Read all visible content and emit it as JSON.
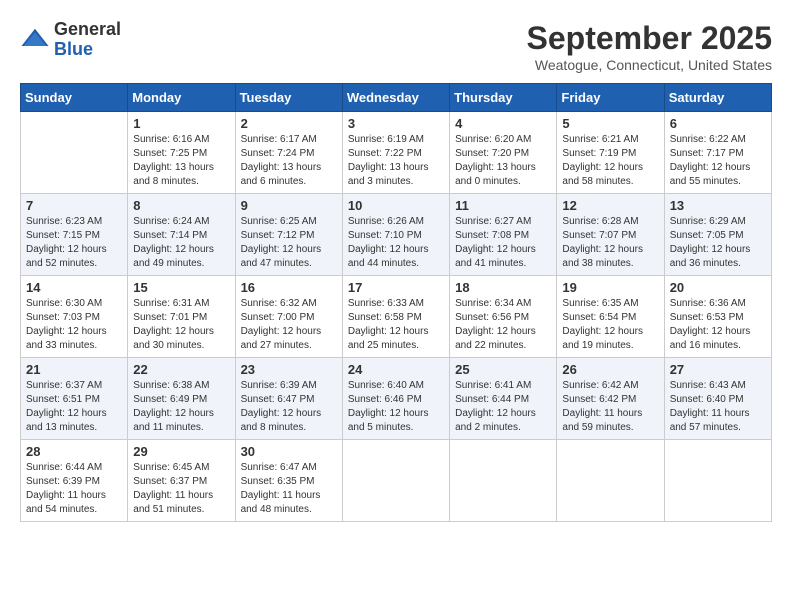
{
  "header": {
    "logo": {
      "general": "General",
      "blue": "Blue"
    },
    "month": "September 2025",
    "location": "Weatogue, Connecticut, United States"
  },
  "calendar": {
    "days_of_week": [
      "Sunday",
      "Monday",
      "Tuesday",
      "Wednesday",
      "Thursday",
      "Friday",
      "Saturday"
    ],
    "weeks": [
      [
        {
          "day": "",
          "info": ""
        },
        {
          "day": "1",
          "info": "Sunrise: 6:16 AM\nSunset: 7:25 PM\nDaylight: 13 hours\nand 8 minutes."
        },
        {
          "day": "2",
          "info": "Sunrise: 6:17 AM\nSunset: 7:24 PM\nDaylight: 13 hours\nand 6 minutes."
        },
        {
          "day": "3",
          "info": "Sunrise: 6:19 AM\nSunset: 7:22 PM\nDaylight: 13 hours\nand 3 minutes."
        },
        {
          "day": "4",
          "info": "Sunrise: 6:20 AM\nSunset: 7:20 PM\nDaylight: 13 hours\nand 0 minutes."
        },
        {
          "day": "5",
          "info": "Sunrise: 6:21 AM\nSunset: 7:19 PM\nDaylight: 12 hours\nand 58 minutes."
        },
        {
          "day": "6",
          "info": "Sunrise: 6:22 AM\nSunset: 7:17 PM\nDaylight: 12 hours\nand 55 minutes."
        }
      ],
      [
        {
          "day": "7",
          "info": "Sunrise: 6:23 AM\nSunset: 7:15 PM\nDaylight: 12 hours\nand 52 minutes."
        },
        {
          "day": "8",
          "info": "Sunrise: 6:24 AM\nSunset: 7:14 PM\nDaylight: 12 hours\nand 49 minutes."
        },
        {
          "day": "9",
          "info": "Sunrise: 6:25 AM\nSunset: 7:12 PM\nDaylight: 12 hours\nand 47 minutes."
        },
        {
          "day": "10",
          "info": "Sunrise: 6:26 AM\nSunset: 7:10 PM\nDaylight: 12 hours\nand 44 minutes."
        },
        {
          "day": "11",
          "info": "Sunrise: 6:27 AM\nSunset: 7:08 PM\nDaylight: 12 hours\nand 41 minutes."
        },
        {
          "day": "12",
          "info": "Sunrise: 6:28 AM\nSunset: 7:07 PM\nDaylight: 12 hours\nand 38 minutes."
        },
        {
          "day": "13",
          "info": "Sunrise: 6:29 AM\nSunset: 7:05 PM\nDaylight: 12 hours\nand 36 minutes."
        }
      ],
      [
        {
          "day": "14",
          "info": "Sunrise: 6:30 AM\nSunset: 7:03 PM\nDaylight: 12 hours\nand 33 minutes."
        },
        {
          "day": "15",
          "info": "Sunrise: 6:31 AM\nSunset: 7:01 PM\nDaylight: 12 hours\nand 30 minutes."
        },
        {
          "day": "16",
          "info": "Sunrise: 6:32 AM\nSunset: 7:00 PM\nDaylight: 12 hours\nand 27 minutes."
        },
        {
          "day": "17",
          "info": "Sunrise: 6:33 AM\nSunset: 6:58 PM\nDaylight: 12 hours\nand 25 minutes."
        },
        {
          "day": "18",
          "info": "Sunrise: 6:34 AM\nSunset: 6:56 PM\nDaylight: 12 hours\nand 22 minutes."
        },
        {
          "day": "19",
          "info": "Sunrise: 6:35 AM\nSunset: 6:54 PM\nDaylight: 12 hours\nand 19 minutes."
        },
        {
          "day": "20",
          "info": "Sunrise: 6:36 AM\nSunset: 6:53 PM\nDaylight: 12 hours\nand 16 minutes."
        }
      ],
      [
        {
          "day": "21",
          "info": "Sunrise: 6:37 AM\nSunset: 6:51 PM\nDaylight: 12 hours\nand 13 minutes."
        },
        {
          "day": "22",
          "info": "Sunrise: 6:38 AM\nSunset: 6:49 PM\nDaylight: 12 hours\nand 11 minutes."
        },
        {
          "day": "23",
          "info": "Sunrise: 6:39 AM\nSunset: 6:47 PM\nDaylight: 12 hours\nand 8 minutes."
        },
        {
          "day": "24",
          "info": "Sunrise: 6:40 AM\nSunset: 6:46 PM\nDaylight: 12 hours\nand 5 minutes."
        },
        {
          "day": "25",
          "info": "Sunrise: 6:41 AM\nSunset: 6:44 PM\nDaylight: 12 hours\nand 2 minutes."
        },
        {
          "day": "26",
          "info": "Sunrise: 6:42 AM\nSunset: 6:42 PM\nDaylight: 11 hours\nand 59 minutes."
        },
        {
          "day": "27",
          "info": "Sunrise: 6:43 AM\nSunset: 6:40 PM\nDaylight: 11 hours\nand 57 minutes."
        }
      ],
      [
        {
          "day": "28",
          "info": "Sunrise: 6:44 AM\nSunset: 6:39 PM\nDaylight: 11 hours\nand 54 minutes."
        },
        {
          "day": "29",
          "info": "Sunrise: 6:45 AM\nSunset: 6:37 PM\nDaylight: 11 hours\nand 51 minutes."
        },
        {
          "day": "30",
          "info": "Sunrise: 6:47 AM\nSunset: 6:35 PM\nDaylight: 11 hours\nand 48 minutes."
        },
        {
          "day": "",
          "info": ""
        },
        {
          "day": "",
          "info": ""
        },
        {
          "day": "",
          "info": ""
        },
        {
          "day": "",
          "info": ""
        }
      ]
    ]
  }
}
